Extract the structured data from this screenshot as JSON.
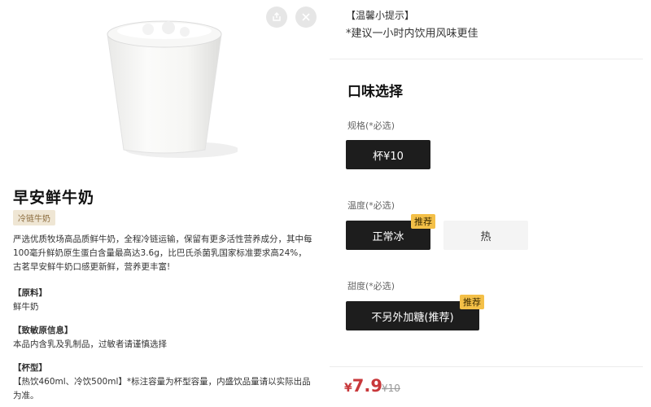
{
  "product": {
    "name": "早安鲜牛奶",
    "tag": "冷链牛奶",
    "description": "严选优质牧场高品质鲜牛奶，全程冷链运输，保留有更多活性营养成分，其中每100毫升鲜奶原生蛋白含量最高达3.6g，比巴氏杀菌乳国家标准要求高24%，古茗早安鲜牛奶口感更新鲜，营养更丰富!",
    "ingredients_title": "【原料】",
    "ingredients": "鲜牛奶",
    "allergen_title": "【致敏原信息】",
    "allergen": "本品内含乳及乳制品，过敏者请谨慎选择",
    "cup_title": "【杯型】",
    "cup": "【热饮460ml、冷饮500ml】*标注容量为杯型容量，内盛饮品量请以实际出品为准。"
  },
  "icons": {
    "share": "share-icon",
    "close": "close-icon"
  },
  "tip": {
    "title": "【温馨小提示】",
    "text": "*建议一小时内饮用风味更佳"
  },
  "options": {
    "title": "口味选择",
    "size": {
      "label": "规格(*必选)",
      "items": [
        {
          "label": "杯¥10",
          "selected": true
        }
      ]
    },
    "temperature": {
      "label": "温度(*必选)",
      "items": [
        {
          "label": "正常冰",
          "selected": true,
          "badge": "推荐"
        },
        {
          "label": "热",
          "selected": false
        }
      ]
    },
    "sweetness": {
      "label": "甜度(*必选)",
      "items": [
        {
          "label": "不另外加糖(推荐)",
          "selected": true,
          "badge": "推荐"
        }
      ]
    }
  },
  "price": {
    "currency": "¥",
    "current": "7.9",
    "original": "¥10"
  },
  "colors": {
    "accent_price": "#c8383b",
    "selected_bg": "#1d1d1d",
    "badge_bg": "#f4c048",
    "tag_bg": "#efe6d4"
  }
}
